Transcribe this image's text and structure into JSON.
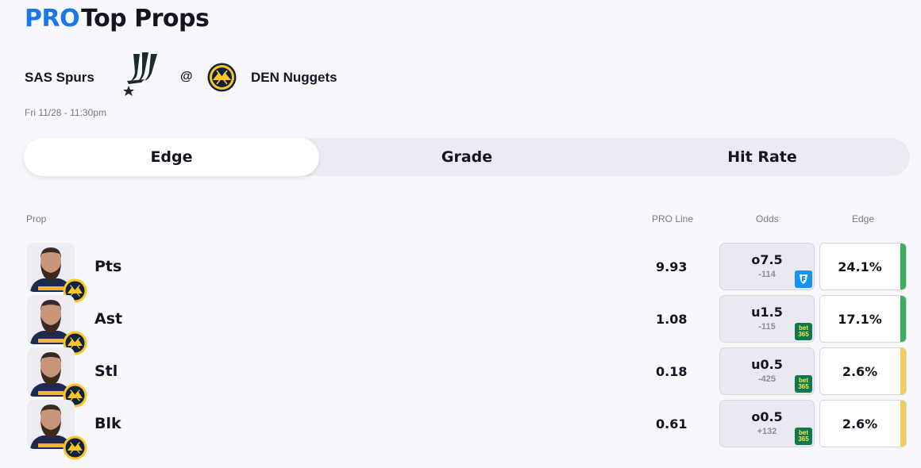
{
  "header": {
    "pro_label": "PRO",
    "title": "Top Props"
  },
  "matchup": {
    "home_team": "SAS Spurs",
    "home_logo": "spurs-logo",
    "at": "@",
    "away_team": "DEN Nuggets",
    "away_logo": "nuggets-logo",
    "datetime": "Fri 11/28 - 11:30pm"
  },
  "tabs": [
    {
      "label": "Edge",
      "active": true
    },
    {
      "label": "Grade",
      "active": false
    },
    {
      "label": "Hit Rate",
      "active": false
    }
  ],
  "table": {
    "headers": {
      "prop": "Prop",
      "pro_line": "PRO Line",
      "odds": "Odds",
      "edge": "Edge"
    },
    "rows": [
      {
        "prop": "Pts",
        "pro_line": "9.93",
        "odds": "o7.5",
        "odds_price": "-114",
        "book": "fanduel-icon",
        "edge": "24.1%",
        "edge_color": "#3aae5c"
      },
      {
        "prop": "Ast",
        "pro_line": "1.08",
        "odds": "u1.5",
        "odds_price": "-115",
        "book": "bet365-icon",
        "edge": "17.1%",
        "edge_color": "#3aae5c"
      },
      {
        "prop": "Stl",
        "pro_line": "0.18",
        "odds": "u0.5",
        "odds_price": "-425",
        "book": "bet365-icon",
        "edge": "2.6%",
        "edge_color": "#f2cc57"
      },
      {
        "prop": "Blk",
        "pro_line": "0.61",
        "odds": "o0.5",
        "odds_price": "+132",
        "book": "bet365-icon",
        "edge": "2.6%",
        "edge_color": "#f2cc57"
      }
    ]
  },
  "bet365_text": [
    "bet",
    "365"
  ],
  "colors": {
    "accent": "#1677f0",
    "positive": "#3aae5c",
    "neutral": "#f2cc57"
  }
}
